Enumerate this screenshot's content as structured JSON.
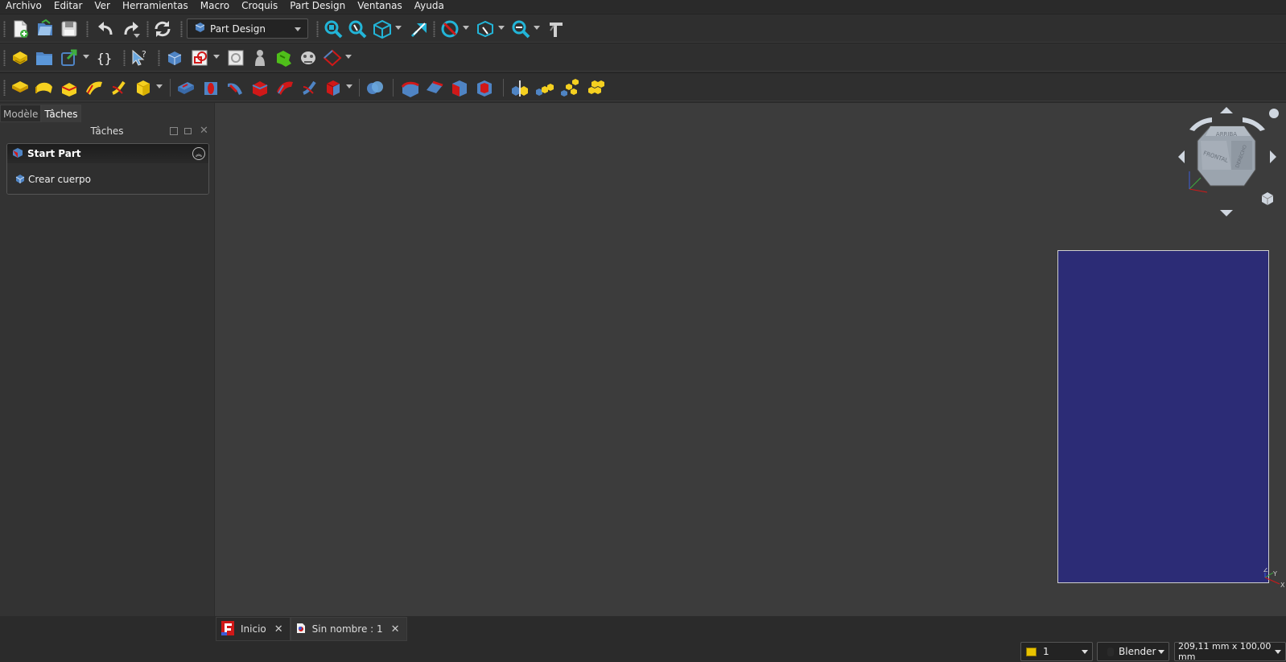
{
  "menu": [
    "Archivo",
    "Editar",
    "Ver",
    "Herramientas",
    "Macro",
    "Croquis",
    "Part Design",
    "Ventanas",
    "Ayuda"
  ],
  "toolbar": {
    "workbench": "Part Design",
    "row1_icons": [
      "new-document-icon",
      "open-document-icon",
      "save-document-icon",
      "undo-icon",
      "redo-icon",
      "refresh-icon",
      "fit-all-icon",
      "fit-selection-icon",
      "isometric-view-icon",
      "measure-icon",
      "draw-style-icon",
      "bounding-box-icon",
      "zoom-box-icon",
      "clipping-plane-icon"
    ],
    "row2_icons": [
      "part-icon",
      "group-icon",
      "link-icon",
      "json-icon",
      "whats-this-icon",
      "body-icon",
      "sketch-icon",
      "attach-sketch-icon",
      "clone-icon",
      "shape-binder-icon",
      "subshape-binder-icon",
      "datum-plane-icon"
    ],
    "row3_icons": [
      "pad-icon",
      "revolution-icon",
      "additive-loft-icon",
      "additive-pipe-icon",
      "additive-helix-icon",
      "additive-box-icon",
      "pocket-icon",
      "hole-icon",
      "groove-icon",
      "subtractive-loft-icon",
      "subtractive-pipe-icon",
      "subtractive-helix-icon",
      "subtractive-box-icon",
      "boolean-icon",
      "fillet-icon",
      "chamfer-icon",
      "draft-icon",
      "thickness-icon",
      "mirrored-icon",
      "linear-pattern-icon",
      "polar-pattern-icon",
      "multi-transform-icon"
    ]
  },
  "panel": {
    "tabs": [
      "Modèle",
      "Tâches"
    ],
    "title": "Tâches",
    "task_title": "Start Part",
    "task_action": "Crear cuerpo"
  },
  "navcube": {
    "top_face": "ARRIBA",
    "front_face": "FRONTAL",
    "right_face": "DERECHO"
  },
  "axes": {
    "x": "X",
    "y": "Y",
    "z": "Z"
  },
  "doc_tabs": [
    {
      "label": "Inicio"
    },
    {
      "label": "Sin nombre : 1"
    }
  ],
  "status": {
    "layer": "1",
    "nav_style": "Blender",
    "dimensions": "209,11 mm x 100,00 mm"
  },
  "colors": {
    "page": "#2c2c76",
    "viewport": "#3c3c3c",
    "accent_yellow": "#e8c200",
    "accent_red": "#d01818",
    "accent_blue": "#4f84c4"
  }
}
